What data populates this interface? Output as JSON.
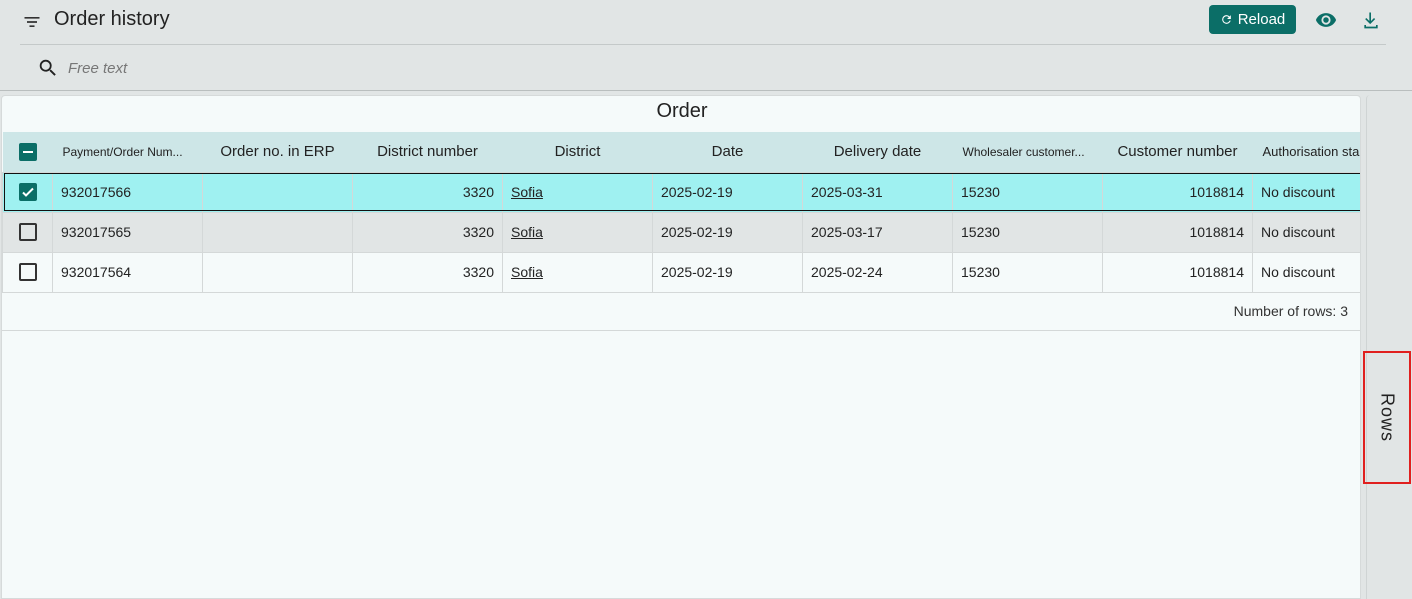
{
  "header": {
    "title": "Order history",
    "reload_label": "Reload",
    "search_placeholder": "Free text"
  },
  "panel": {
    "title": "Order"
  },
  "table": {
    "columns": [
      "Payment/Order Num...",
      "Order no. in ERP",
      "District number",
      "District",
      "Date",
      "Delivery date",
      "Wholesaler customer...",
      "Customer number",
      "Authorisation sta"
    ],
    "rows": [
      {
        "checked": true,
        "payment_order_num": "932017566",
        "erp_no": "",
        "district_number": "3320",
        "district": "Sofia",
        "date": "2025-02-19",
        "delivery_date": "2025-03-31",
        "wholesaler_customer": "15230",
        "customer_number": "1018814",
        "authorisation": "No discount"
      },
      {
        "checked": false,
        "payment_order_num": "932017565",
        "erp_no": "",
        "district_number": "3320",
        "district": "Sofia",
        "date": "2025-02-19",
        "delivery_date": "2025-03-17",
        "wholesaler_customer": "15230",
        "customer_number": "1018814",
        "authorisation": "No discount"
      },
      {
        "checked": false,
        "payment_order_num": "932017564",
        "erp_no": "",
        "district_number": "3320",
        "district": "Sofia",
        "date": "2025-02-19",
        "delivery_date": "2025-02-24",
        "wholesaler_customer": "15230",
        "customer_number": "1018814",
        "authorisation": "No discount"
      }
    ],
    "row_count_text": "Number of rows: 3"
  },
  "side_tab": {
    "label": "Rows"
  },
  "colors": {
    "accent": "#0b6e67",
    "selected_row": "#9ff1f1",
    "header_row": "#cde6e7",
    "highlight_border": "#e0201f"
  },
  "icons": {
    "filter": "filter-icon",
    "reload": "refresh-icon",
    "view": "eye-icon",
    "download": "download-icon",
    "search": "search-icon"
  }
}
